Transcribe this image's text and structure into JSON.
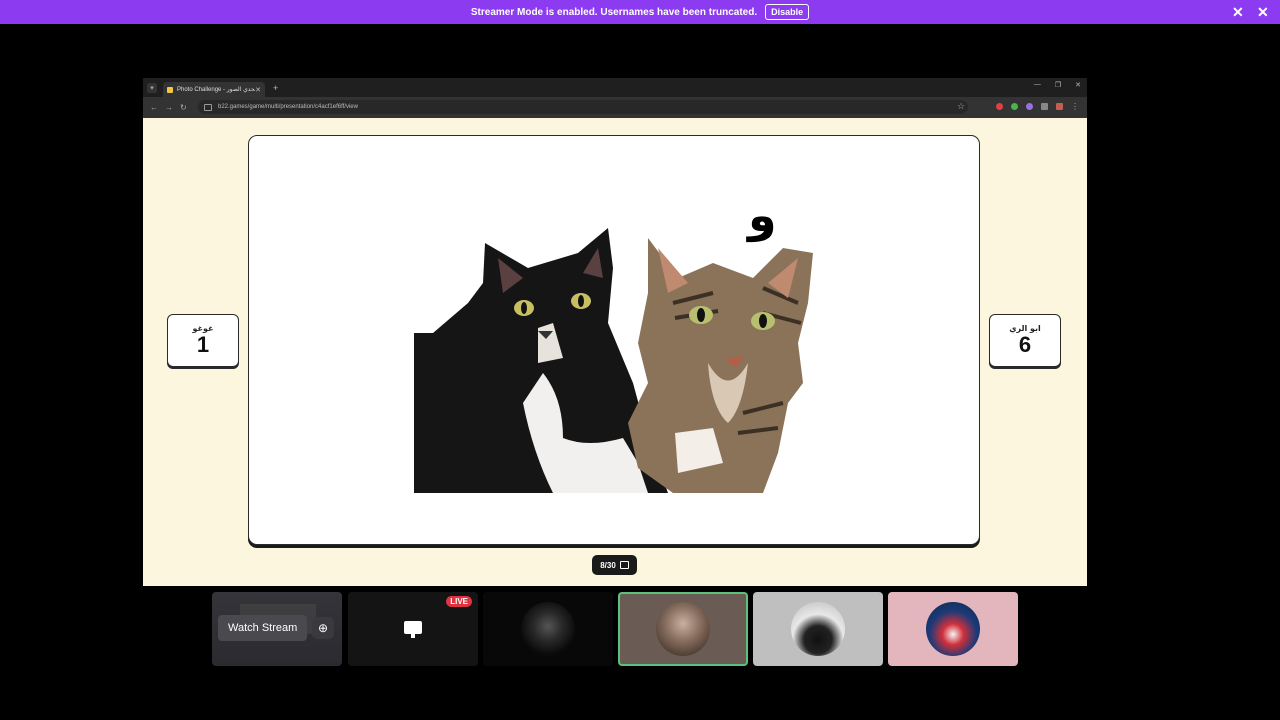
{
  "banner": {
    "message": "Streamer Mode is enabled. Usernames have been truncated.",
    "disable_label": "Disable",
    "color": "#8d3bf0"
  },
  "browser": {
    "tab_title": "Photo Challenge - تحدي الصور",
    "url": "b22.games/game/multi/presentation/c4acf1ef6ff/view"
  },
  "game": {
    "letter": "و",
    "left_player": {
      "name": "غوغو",
      "score": "1"
    },
    "right_player": {
      "name": "ابو الري",
      "score": "6"
    },
    "counter": "8/30"
  },
  "tiles": {
    "watch_label": "Watch Stream",
    "live_label": "LIVE",
    "highlight_color": "#5ac27a"
  }
}
